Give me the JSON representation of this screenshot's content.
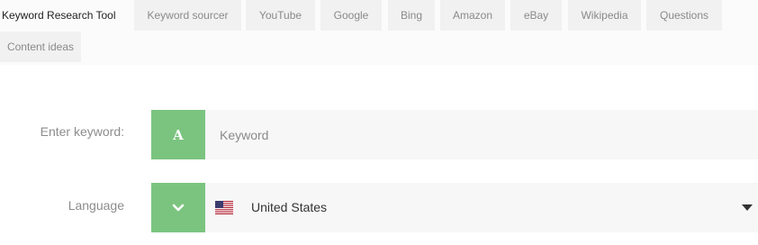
{
  "nav": {
    "tabs": [
      {
        "label": "Keyword Research Tool",
        "active": true
      },
      {
        "label": "Keyword sourcer"
      },
      {
        "label": "YouTube"
      },
      {
        "label": "Google"
      },
      {
        "label": "Bing"
      },
      {
        "label": "Amazon"
      },
      {
        "label": "eBay"
      },
      {
        "label": "Wikipedia"
      },
      {
        "label": "Questions"
      },
      {
        "label": "Content ideas"
      }
    ]
  },
  "form": {
    "keyword": {
      "label": "Enter keyword:",
      "icon_letter": "A",
      "value": "",
      "placeholder": "Keyword"
    },
    "language": {
      "label": "Language",
      "selected": "United States",
      "flag": "us-flag-icon"
    }
  },
  "colors": {
    "accent": "#7bc47f",
    "field_bg": "#f7f7f7",
    "tab_bg": "#f1f1f1"
  }
}
